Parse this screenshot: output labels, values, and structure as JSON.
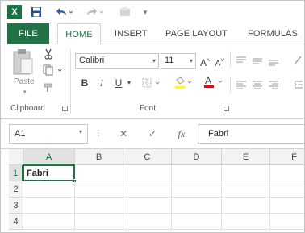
{
  "app": {
    "logo_text": "X"
  },
  "tabs": {
    "file": "FILE",
    "home": "HOME",
    "insert": "INSERT",
    "page_layout": "PAGE LAYOUT",
    "formulas": "FORMULAS"
  },
  "ribbon": {
    "clipboard": {
      "paste_label": "Paste",
      "group_label": "Clipboard"
    },
    "font": {
      "font_name": "Calibri",
      "font_size": "11",
      "bold": "B",
      "italic": "I",
      "underline": "U",
      "group_label": "Font",
      "font_color": "#ff0000"
    }
  },
  "formula_bar": {
    "name_box": "A1",
    "cancel_symbol": "✕",
    "enter_symbol": "✓",
    "function_symbol": "fx",
    "value": "Fabri"
  },
  "sheet": {
    "columns": [
      "A",
      "B",
      "C",
      "D",
      "E",
      "F"
    ],
    "rows": [
      "1",
      "2",
      "3",
      "4"
    ],
    "cells": {
      "A1": "Fabri"
    }
  },
  "colors": {
    "accent": "#217346",
    "file_tab": "#217346"
  }
}
